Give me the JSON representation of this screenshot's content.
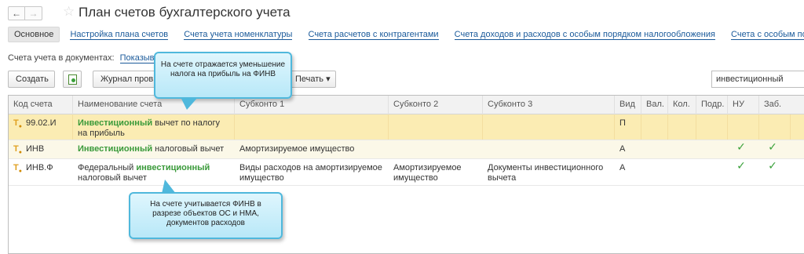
{
  "window": {
    "back_label": "←",
    "forward_label": "→",
    "favorite_glyph": "☆",
    "title": "План счетов бухгалтерского учета"
  },
  "tabs": [
    {
      "label": "Основное",
      "active": true
    },
    {
      "label": "Настройка плана счетов"
    },
    {
      "label": "Счета учета номенклатуры"
    },
    {
      "label": "Счета расчетов с контрагентами"
    },
    {
      "label": "Счета доходов и расходов с особым порядком налогообложения"
    },
    {
      "label": "Счета с особым порядко"
    }
  ],
  "doc_accounts": {
    "label": "Счета учета в документах:",
    "link": "Показыв"
  },
  "toolbar": {
    "create_label": "Создать",
    "journal_label": "Журнал пров",
    "print_label": "Печать",
    "print_caret": "▾",
    "search_value": "инвестиционный"
  },
  "table": {
    "headers": [
      "Код счета",
      "Наименование счета",
      "Субконто 1",
      "Субконто 2",
      "Субконто 3",
      "Вид",
      "Вал.",
      "Кол.",
      "Подр.",
      "НУ",
      "Заб."
    ],
    "rows": [
      {
        "code": "99.02.И",
        "name_hl": "Инвестиционный",
        "name_rest": " вычет по налогу на прибыль",
        "sub1": "",
        "sub2": "",
        "sub3": "",
        "kind": "П",
        "nu": "",
        "zab": ""
      },
      {
        "code": "ИНВ",
        "name_hl": "Инвестиционный",
        "name_rest": " налоговый вычет",
        "sub1": "Амортизируемое имущество",
        "sub2": "",
        "sub3": "",
        "kind": "А",
        "nu": "✓",
        "zab": "✓"
      },
      {
        "code": "ИНВ.Ф",
        "name_pre": "Федеральный ",
        "name_hl": "инвестиционный",
        "name_rest": " налоговый вычет",
        "sub1": "Виды расходов на амортизируемое имущество",
        "sub2": "Амортизируемое имущество",
        "sub3": "Документы инвестиционного вычета",
        "kind": "А",
        "nu": "✓",
        "zab": "✓"
      }
    ]
  },
  "callouts": {
    "top": "На счете отражается уменьшение налога на прибыль на ФИНВ",
    "bottom": "На счете учитывается ФИНВ в разрезе объектов ОС и НМА, документов расходов"
  },
  "colors": {
    "accent_link": "#1a5a9a",
    "highlight_text": "#3a9a3a",
    "selected_row": "#fbecb3",
    "callout_border": "#4fb8dc"
  }
}
